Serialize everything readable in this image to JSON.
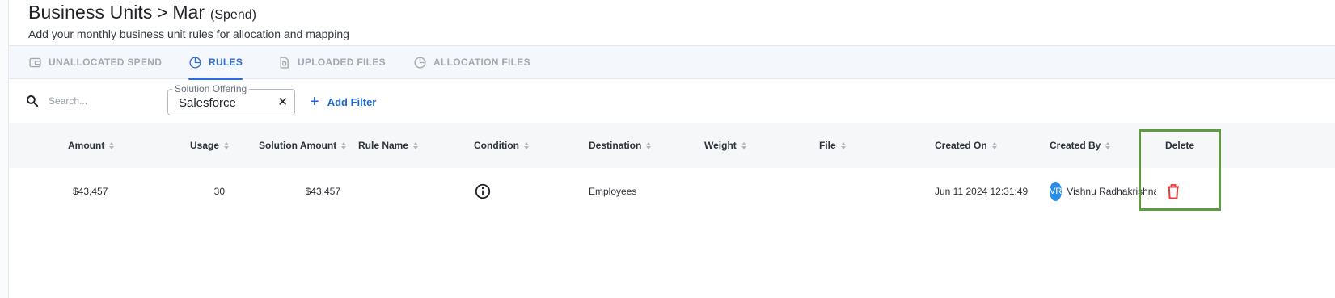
{
  "header": {
    "title": "Business Units",
    "separator": ">",
    "month": "Mar",
    "paren": "(Spend)",
    "subtitle": "Add your monthly business unit rules for allocation and mapping"
  },
  "tabs": [
    {
      "label": "UNALLOCATED SPEND",
      "icon": "wallet-icon",
      "active": false
    },
    {
      "label": "RULES",
      "icon": "pie-chart-icon",
      "active": true
    },
    {
      "label": "UPLOADED FILES",
      "icon": "file-icon",
      "active": false
    },
    {
      "label": "ALLOCATION FILES",
      "icon": "pie-chart-icon",
      "active": false
    }
  ],
  "toolbar": {
    "search_placeholder": "Search...",
    "filter_label": "Solution Offering",
    "filter_value": "Salesforce",
    "filter_clear": "✕",
    "add_filter_label": "Add Filter"
  },
  "table": {
    "columns": [
      "Amount",
      "Usage",
      "Solution Amount",
      "Rule Name",
      "Condition",
      "Destination",
      "Weight",
      "File",
      "Created On",
      "Created By",
      "Delete"
    ],
    "rows": [
      {
        "amount": "$43,457",
        "usage": "30",
        "solution_amount": "$43,457",
        "rule_name": "",
        "condition_icon": "info-icon",
        "destination": "Employees",
        "weight": "",
        "file": "",
        "created_on": "Jun 11 2024 12:31:49",
        "avatar_initials": "VR",
        "created_by": "Vishnu Radhakrishnan",
        "delete_icon": "trash-icon"
      }
    ]
  },
  "colors": {
    "accent": "#2d6dd6",
    "avatar": "#2a8ee8",
    "delete": "#e53935",
    "highlight": "#5e9b3f"
  }
}
